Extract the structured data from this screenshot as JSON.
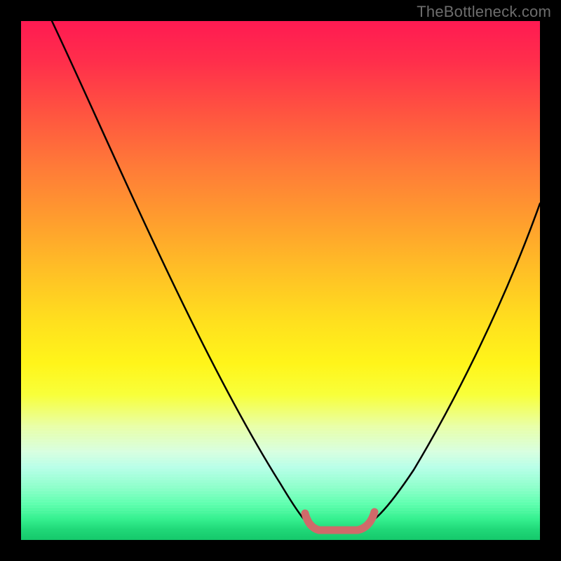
{
  "watermark": {
    "text": "TheBottleneck.com"
  },
  "colors": {
    "gradient_top": "#ff1a52",
    "gradient_mid": "#ffe01e",
    "gradient_bottom": "#15c86b",
    "curve": "#000000",
    "optimal_marker": "#cf6a6a",
    "background": "#000000",
    "watermark": "#6d6d6d"
  },
  "chart_data": {
    "type": "line",
    "title": "",
    "xlabel": "",
    "ylabel": "",
    "xlim": [
      0,
      100
    ],
    "ylim": [
      0,
      100
    ],
    "legend_position": "none",
    "optimal_range_x": [
      55,
      67
    ],
    "series": [
      {
        "name": "bottleneck-curve",
        "x": [
          6,
          10,
          15,
          20,
          25,
          30,
          35,
          40,
          45,
          50,
          55,
          57,
          60,
          63,
          65,
          67,
          70,
          75,
          80,
          85,
          90,
          95,
          100
        ],
        "values": [
          100,
          94,
          85,
          76,
          66,
          56,
          46,
          36,
          26,
          16,
          6,
          3,
          1,
          1,
          1,
          3,
          8,
          17,
          27,
          37,
          48,
          57,
          65
        ]
      },
      {
        "name": "optimal-flat",
        "x": [
          55,
          57,
          60,
          63,
          65,
          67
        ],
        "values": [
          4,
          2.5,
          2,
          2,
          2.5,
          4
        ]
      }
    ]
  }
}
